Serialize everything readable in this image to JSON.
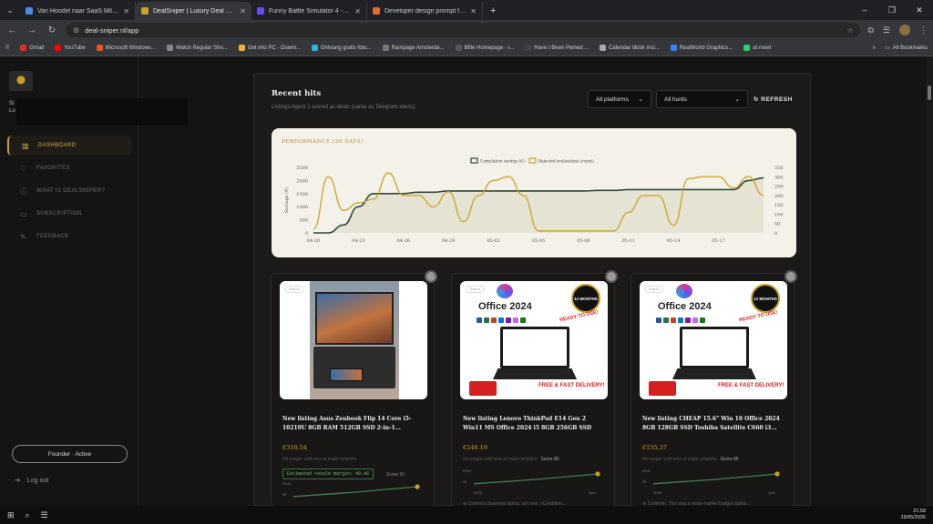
{
  "browser": {
    "tabs": [
      {
        "title": "Van Hoodel naar SaaS Miljarda...",
        "color": "#4d8be0",
        "active": false
      },
      {
        "title": "DealSniper | Luxury Deal Hunte...",
        "color": "#c9a227",
        "active": true
      },
      {
        "title": "Funny Battle Simulator 4 - Play",
        "color": "#6a4df2",
        "active": false
      },
      {
        "title": "Developer design prompt for u...",
        "color": "#e06a3b",
        "active": false
      }
    ],
    "url": "deal-sniper.nl/app",
    "bookmarks": [
      {
        "label": "Gmail",
        "color": "#d93025"
      },
      {
        "label": "YouTube",
        "color": "#ff0000"
      },
      {
        "label": "Microsoft Windows...",
        "color": "#f25022"
      },
      {
        "label": "Watch Regular Sho...",
        "color": "#888888"
      },
      {
        "label": "Get into PC - Downl...",
        "color": "#f2b233"
      },
      {
        "label": "Ontvang gratis foto...",
        "color": "#2bb6d9"
      },
      {
        "label": "Rampage Amsterda...",
        "color": "#777777"
      },
      {
        "label": "Bfile Homepage - I...",
        "color": "#555555"
      },
      {
        "label": "Have I Been Pwned:...",
        "color": "#444444"
      },
      {
        "label": "Calendar tiktok inci...",
        "color": "#aaaaaa"
      },
      {
        "label": "RealWorld Graphics...",
        "color": "#3b82f6"
      },
      {
        "label": "at moet",
        "color": "#25d366"
      }
    ],
    "all_bookmarks": "All Bookmarks",
    "more": "»"
  },
  "sidebar": {
    "user_line1": "Si",
    "user_line2": "Lo",
    "items": [
      {
        "label": "DASHBOARD",
        "icon": "bar-chart-icon",
        "glyph": "▥",
        "active": true
      },
      {
        "label": "FAVORITES",
        "icon": "heart-icon",
        "glyph": "♡",
        "active": false
      },
      {
        "label": "WHAT IS DEALSNIPER?",
        "icon": "info-icon",
        "glyph": "ⓘ",
        "active": false
      },
      {
        "label": "SUBSCRIPTION",
        "icon": "card-icon",
        "glyph": "▭",
        "active": false
      },
      {
        "label": "FEEDBACK",
        "icon": "chat-icon",
        "glyph": "✎",
        "active": false
      }
    ],
    "plan": "Founder · Active",
    "logout": "Log out"
  },
  "header": {
    "title": "Recent hits",
    "subtitle": "Listings Agent 2 scored as deals (same as Telegram alerts).",
    "platform_select": "All platforms",
    "hunt_select": "All hunts",
    "refresh": "↻ REFRESH"
  },
  "chart_data": {
    "type": "line",
    "title": "PERFORMANCE (30 DAYS)",
    "legend_position": "top",
    "ylabel_left": "Savings (€)",
    "x_ticks": [
      "04-20",
      "04-23",
      "04-26",
      "04-29",
      "05-02",
      "05-05",
      "05-08",
      "05-11",
      "05-14",
      "05-17"
    ],
    "y_left_ticks": [
      0,
      500,
      1000,
      1500,
      2000,
      2500
    ],
    "y_right_ticks": [
      0,
      50,
      100,
      150,
      200,
      250,
      300,
      350
    ],
    "ylim_left": [
      0,
      2500
    ],
    "ylim_right": [
      0,
      350
    ],
    "series": [
      {
        "name": "Cumulative savings (€)",
        "axis": "left",
        "color": "#2f4a36",
        "values": [
          0,
          0,
          300,
          1000,
          1500,
          1500,
          1500,
          1550,
          1550,
          1600,
          1600,
          1600,
          1600,
          1600,
          1600,
          1600,
          1600,
          1600,
          1600,
          1620,
          1620,
          1650,
          1650,
          1650,
          1650,
          1650,
          1650,
          1650,
          1650,
          2000,
          2100
        ]
      },
      {
        "name": "Rejected evaluations (count)",
        "axis": "right",
        "color": "#c9a227",
        "values": [
          20,
          300,
          120,
          160,
          180,
          320,
          200,
          200,
          140,
          220,
          60,
          200,
          280,
          300,
          200,
          10,
          10,
          10,
          10,
          10,
          10,
          110,
          200,
          200,
          40,
          290,
          300,
          300,
          240,
          300,
          200
        ]
      }
    ]
  },
  "cards": [
    {
      "chip": "Chat lin",
      "image": "laptop-photo",
      "title": "New listing Asus Zenbook Flip 14 Core i5-10210U 8GB RAM 512GB SSD 2-in-1...",
      "price": "€316.54",
      "meta": "No longer sold new at major retailers",
      "score": "",
      "badge": "Estimated resale margin: 48.46",
      "badge_score": "Score 90",
      "spark_labels": [
        "€146",
        "0€"
      ],
      "spark_values": [
        0.1,
        0.5,
        1.0
      ],
      "foot": ""
    },
    {
      "chip": "Chat lin",
      "image": "office-2024",
      "title": "New listing Lenovo ThinkPad E14 Gen 2 Win11 MS Office 2024 i5 8GB 256GB SSD FAST 14\"...",
      "price": "€246.19",
      "meta": "No longer sold new at major retailers",
      "score": "Score 80",
      "badge": "",
      "badge_score": "",
      "spark_labels": [
        "€300",
        "0€",
        "2026",
        "nom"
      ],
      "spark_values": [
        0.1,
        0.5,
        1.0
      ],
      "foot": "⊕ Common business laptop, not new. | Condition..."
    },
    {
      "chip": "Chat lin",
      "image": "office-2024",
      "title": "New listing CHEAP 15.6\" Win 10 Office 2024 8GB 128GB SSD Toshiba Satellite C660 i3...",
      "price": "€155.37",
      "meta": "No longer sold new at major retailers",
      "score": "Score 95",
      "badge": "",
      "badge_score": "",
      "spark_labels": [
        "€300",
        "0€",
        "2026",
        "nom"
      ],
      "spark_values": [
        0.1,
        0.5,
        1.0
      ],
      "foot": "⊕ Common. This was a mass-market budget laptop..."
    }
  ],
  "office": {
    "logo": "Office 2024",
    "months": "12 MONTHS",
    "ready": "READY TO USE!",
    "free": "FREE & FAST DELIVERY!"
  },
  "taskbar": {
    "time": "21:58",
    "date": "19/05/2026"
  }
}
